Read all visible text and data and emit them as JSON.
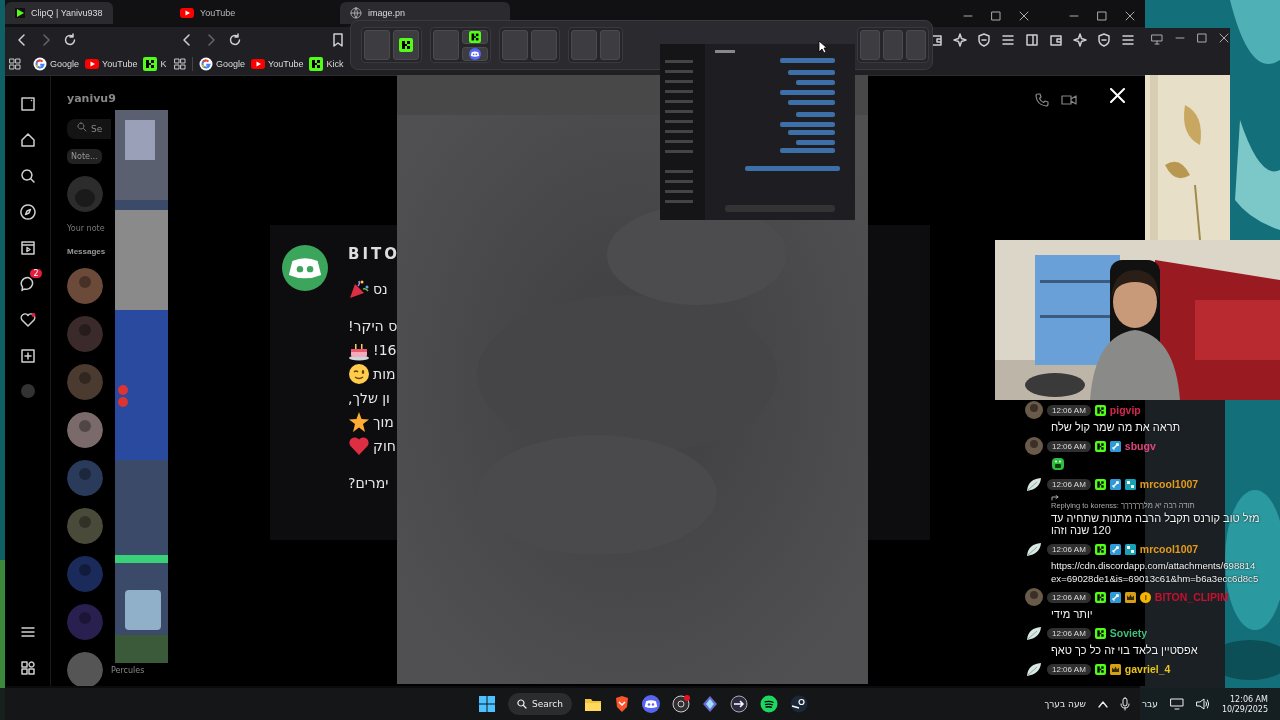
{
  "browser_left": {
    "tab": "ClipQ | Yanivu938",
    "bookmarks": [
      {
        "kind": "google",
        "label": "Google"
      },
      {
        "kind": "youtube",
        "label": "YouTube"
      },
      {
        "kind": "kick",
        "label": "K"
      }
    ]
  },
  "instagram": {
    "username": "yanivu9",
    "search": {
      "placeholder": "Se"
    },
    "note": "Note...",
    "note_caption": "Your note",
    "messages_heading": "Messages",
    "unread_count": "2",
    "bottom_contact": "Percules"
  },
  "browser_main": {
    "tabs": [
      {
        "title": "YouTube",
        "selected": false
      },
      {
        "title": "image.pn",
        "selected": true
      }
    ],
    "bookmarks": [
      {
        "kind": "google",
        "label": "Google"
      },
      {
        "kind": "youtube",
        "label": "YouTube"
      },
      {
        "kind": "kick",
        "label": "Kick"
      }
    ]
  },
  "notification": {
    "sender": "BITO",
    "paragraphs": [
      [
        {
          "kind": "party",
          "text": "נס"
        }
      ],
      [
        {
          "kind": "text",
          "text": "ס היקר!"
        },
        {
          "kind": "cake",
          "text": "16!"
        },
        {
          "kind": "wink",
          "text": "מות"
        },
        {
          "kind": "text",
          "text": "ון שלך,"
        },
        {
          "kind": "star",
          "text": "מוך"
        },
        {
          "kind": "heart",
          "text": "חוק"
        }
      ],
      [
        {
          "kind": "text",
          "text": "ימרים?"
        }
      ]
    ]
  },
  "chat": {
    "messages": [
      {
        "time": "12:06 AM",
        "badges": [
          {
            "kind": "kick"
          }
        ],
        "username": "pigvip",
        "color": "#d6264f",
        "emote": false,
        "lines": [
          "תראה את מה שמר קול שלח"
        ]
      },
      {
        "time": "12:06 AM",
        "badges": [
          {
            "kind": "kick"
          },
          {
            "kind": "mod"
          }
        ],
        "username": "sbugv",
        "color": "#e0457f",
        "emote": true
      },
      {
        "kind": "leaf",
        "time": "12:06 AM",
        "badges": [
          {
            "kind": "kick"
          },
          {
            "kind": "mod"
          },
          {
            "kind": "sub"
          }
        ],
        "username": "mrcool1007",
        "color": "#e39b1c",
        "emote": false,
        "reply": "Replying to korenss: תודה רבה יא מלךךךךךך",
        "lines": [
          "מזל טוב קורנס תקבל הרבה מתנות שתחיה עד 120 שנה וזהו"
        ]
      },
      {
        "kind": "leaf",
        "time": "12:06 AM",
        "badges": [
          {
            "kind": "kick"
          },
          {
            "kind": "mod"
          },
          {
            "kind": "sub"
          }
        ],
        "username": "mrcool1007",
        "color": "#e39b1c",
        "emote": false,
        "lines": [
          "https://cdn.discordapp.com/attachments/698814",
          "ex=69028de1&is=69013c61&hm=b6a3ecc6d8c5"
        ],
        "link": true
      },
      {
        "time": "12:06 AM",
        "badges": [
          {
            "kind": "kick"
          },
          {
            "kind": "mod"
          },
          {
            "kind": "crown"
          },
          {
            "kind": "coin"
          }
        ],
        "username": "BITON_CLIPIM",
        "color": "#c8102e",
        "emote": false,
        "lines": [
          "יותר מידי"
        ]
      },
      {
        "kind": "leaf",
        "time": "12:06 AM",
        "badges": [
          {
            "kind": "kick"
          }
        ],
        "username": "Soviety",
        "color": "#3fbf7f",
        "emote": false,
        "lines": [
          "אפסטיין בלאד בוי זה כל כך טאף"
        ]
      },
      {
        "kind": "leaf",
        "time": "12:06 AM",
        "badges": [
          {
            "kind": "kick"
          },
          {
            "kind": "crown"
          }
        ],
        "username": "gavriel_4",
        "color": "#e8c41c",
        "emote": false
      }
    ]
  },
  "taskbar": {
    "search": "Search",
    "tray_text": "שעה בערך",
    "language": "עבר",
    "time": "12:06 AM",
    "date": "10/29/2025"
  }
}
